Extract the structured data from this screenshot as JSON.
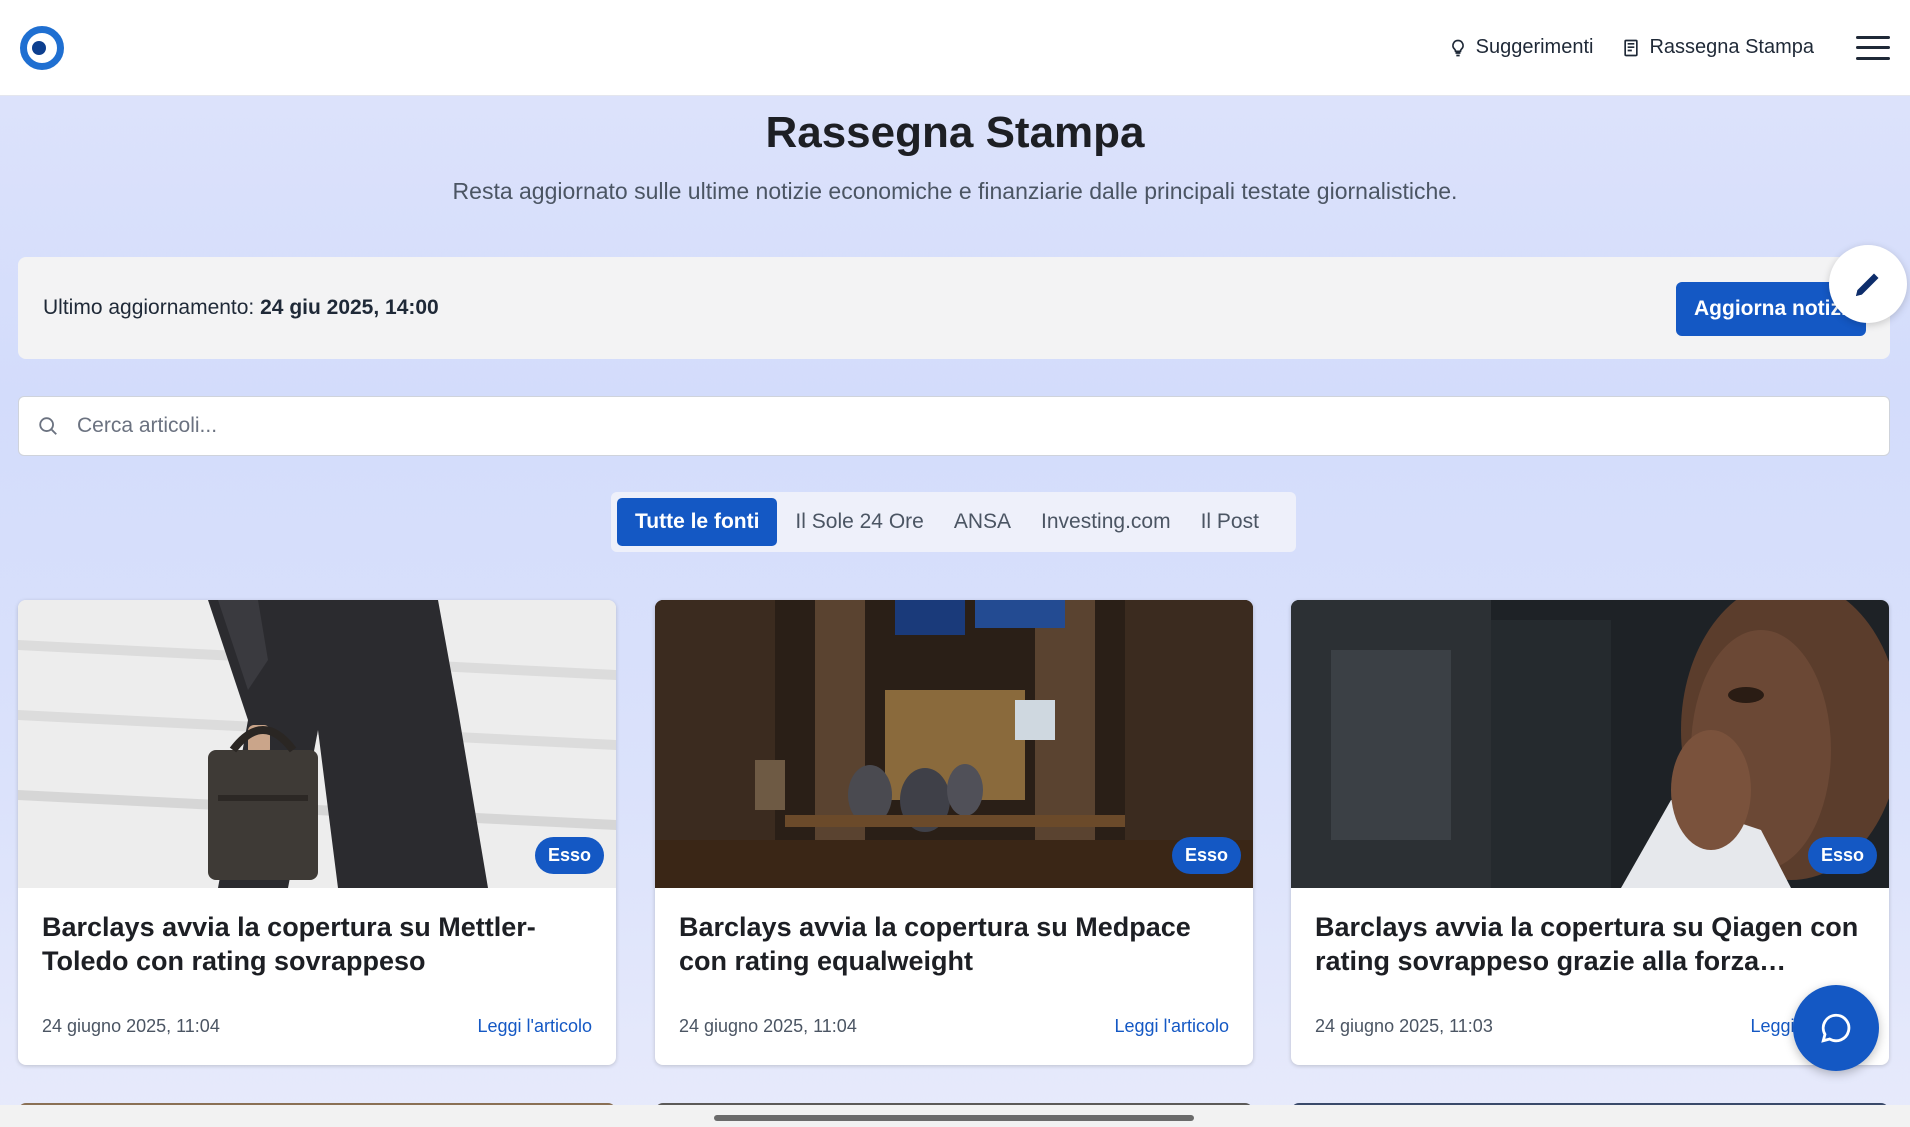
{
  "header": {
    "nav": [
      {
        "label": "Suggerimenti",
        "icon": "lightbulb-icon"
      },
      {
        "label": "Rassegna Stampa",
        "icon": "newspaper-icon"
      }
    ],
    "menu_icon": "hamburger-menu-icon"
  },
  "hero": {
    "title": "Rassegna Stampa",
    "subtitle": "Resta aggiornato sulle ultime notizie economiche e finanziarie dalle principali testate giornalistiche."
  },
  "update_bar": {
    "label": "Ultimo aggiornamento:",
    "timestamp": "24 giu 2025, 14:00",
    "button": "Aggiorna notizie"
  },
  "search": {
    "placeholder": "Cerca articoli..."
  },
  "tabs": [
    {
      "label": "Tutte le fonti",
      "active": true
    },
    {
      "label": "Il Sole 24 Ore",
      "active": false
    },
    {
      "label": "ANSA",
      "active": false
    },
    {
      "label": "Investing.com",
      "active": false
    },
    {
      "label": "Il Post",
      "active": false
    }
  ],
  "articles": [
    {
      "badge": "Esso",
      "title": "Barclays avvia la copertura su Mettler-Toledo con rating sovrappeso",
      "date": "24 giugno 2025, 11:04",
      "link": "Leggi l'articolo"
    },
    {
      "badge": "Esso",
      "title": "Barclays avvia la copertura su Medpace con rating equalweight",
      "date": "24 giugno 2025, 11:04",
      "link": "Leggi l'articolo"
    },
    {
      "badge": "Esso",
      "title": "Barclays avvia la copertura su Qiagen con rating sovrappeso grazie alla forza…",
      "date": "24 giugno 2025, 11:03",
      "link": "Leggi l'articolo"
    }
  ],
  "colors": {
    "accent": "#1458c4",
    "header_bg": "#ffffff",
    "page_bg": "#d8dffb"
  }
}
